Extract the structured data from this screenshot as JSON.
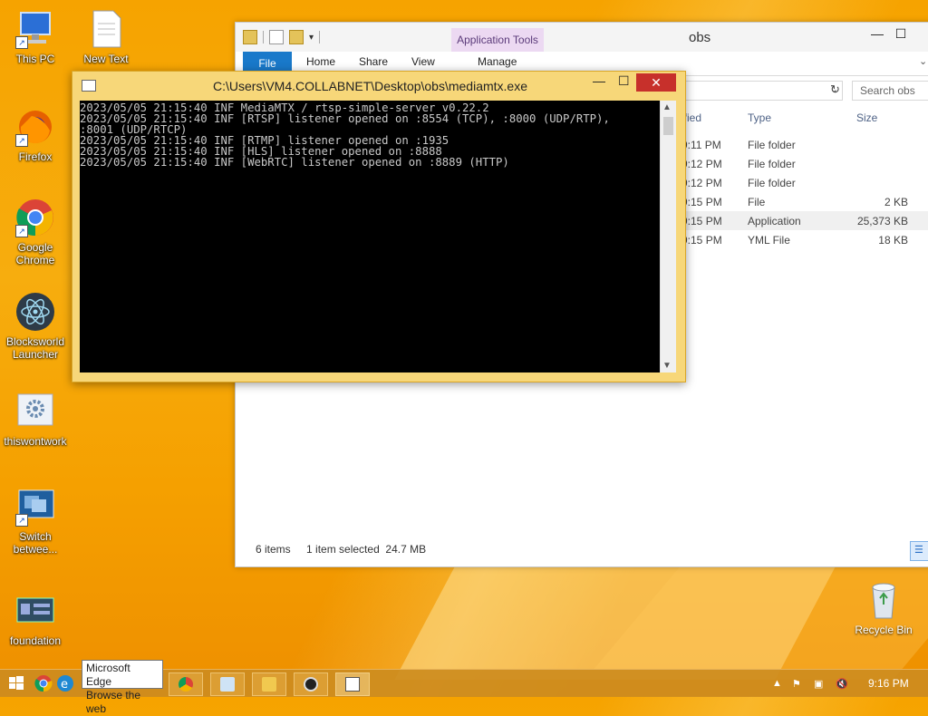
{
  "desktop": {
    "icons": [
      {
        "label": "This PC"
      },
      {
        "label": "New Text Document"
      },
      {
        "label": "Firefox"
      },
      {
        "label": "Google Chrome"
      },
      {
        "label": "Blocksworld Launcher"
      },
      {
        "label": "thiswontwork"
      },
      {
        "label": "Switch betwee..."
      },
      {
        "label": "foundation"
      },
      {
        "label": "Recycle Bin"
      }
    ]
  },
  "explorer": {
    "title": "obs",
    "context_tab": "Application Tools",
    "tabs": [
      "File",
      "Home",
      "Share",
      "View",
      "Manage"
    ],
    "search_placeholder": "Search obs",
    "columns": {
      "modified": "ified",
      "type": "Type",
      "size": "Size"
    },
    "rows": [
      {
        "time": "9:11 PM",
        "type": "File folder",
        "size": ""
      },
      {
        "time": "9:12 PM",
        "type": "File folder",
        "size": ""
      },
      {
        "time": "9:12 PM",
        "type": "File folder",
        "size": ""
      },
      {
        "time": "9:15 PM",
        "type": "File",
        "size": "2 KB"
      },
      {
        "time": "9:15 PM",
        "type": "Application",
        "size": "25,373 KB"
      },
      {
        "time": "9:15 PM",
        "type": "YML File",
        "size": "18 KB"
      }
    ],
    "status": {
      "items": "6 items",
      "selected": "1 item selected  24.7 MB"
    }
  },
  "console": {
    "title": "C:\\Users\\VM4.COLLABNET\\Desktop\\obs\\mediamtx.exe",
    "output": "2023/05/05 21:15:40 INF MediaMTX / rtsp-simple-server v0.22.2\n2023/05/05 21:15:40 INF [RTSP] listener opened on :8554 (TCP), :8000 (UDP/RTP),\n:8001 (UDP/RTCP)\n2023/05/05 21:15:40 INF [RTMP] listener opened on :1935\n2023/05/05 21:15:40 INF [HLS] listener opened on :8888\n2023/05/05 21:15:40 INF [WebRTC] listener opened on :8889 (HTTP)"
  },
  "tooltip": {
    "line1": "Microsoft Edge",
    "line2": "Browse the web"
  },
  "taskbar": {
    "clock": "9:16 PM"
  }
}
